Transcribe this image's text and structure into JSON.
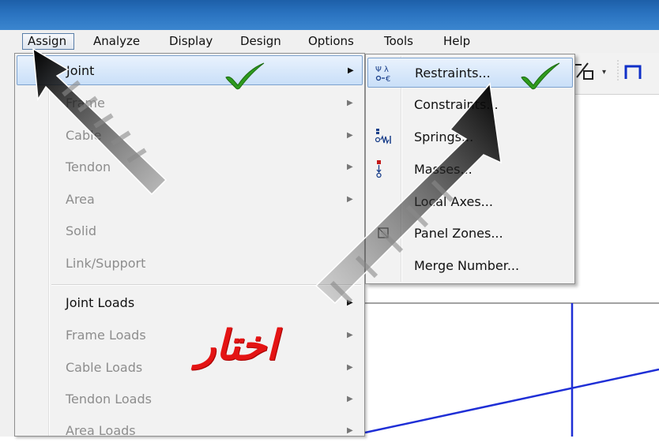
{
  "menubar": {
    "items": [
      {
        "label": "Assign",
        "active": true
      },
      {
        "label": "Analyze"
      },
      {
        "label": "Display"
      },
      {
        "label": "Design"
      },
      {
        "label": "Options"
      },
      {
        "label": "Tools"
      },
      {
        "label": "Help"
      }
    ]
  },
  "assign_menu": {
    "items": [
      {
        "label": "Joint",
        "enabled": true,
        "submenu": true,
        "highlighted": true
      },
      {
        "label": "Frame",
        "enabled": false,
        "submenu": true
      },
      {
        "label": "Cable",
        "enabled": false,
        "submenu": true
      },
      {
        "label": "Tendon",
        "enabled": false,
        "submenu": true
      },
      {
        "label": "Area",
        "enabled": false,
        "submenu": true
      },
      {
        "label": "Solid",
        "enabled": false,
        "submenu": false
      },
      {
        "label": "Link/Support",
        "enabled": false,
        "submenu": false
      },
      {
        "label": "Joint Loads",
        "enabled": true,
        "submenu": true
      },
      {
        "label": "Frame Loads",
        "enabled": false,
        "submenu": true
      },
      {
        "label": "Cable Loads",
        "enabled": false,
        "submenu": true
      },
      {
        "label": "Tendon Loads",
        "enabled": false,
        "submenu": true
      },
      {
        "label": "Area Loads",
        "enabled": false,
        "submenu": true
      }
    ]
  },
  "joint_submenu": {
    "items": [
      {
        "label": "Restraints...",
        "icon": "restraints-icon",
        "highlighted": true
      },
      {
        "label": "Constraints...",
        "icon": ""
      },
      {
        "label": "Springs...",
        "icon": "springs-icon"
      },
      {
        "label": "Masses...",
        "icon": "masses-icon"
      },
      {
        "label": "Local Axes...",
        "icon": ""
      },
      {
        "label": "Panel Zones...",
        "icon": "panel-zones-icon"
      },
      {
        "label": "Merge Number...",
        "icon": ""
      }
    ]
  },
  "annotation": {
    "text": "اختار",
    "color": "#e41414"
  },
  "colors": {
    "checkmark": "#2e9b1e",
    "title_bar": "#2a73c0",
    "highlight": "#c9dff8",
    "grid_line": "#1f2fd6"
  }
}
